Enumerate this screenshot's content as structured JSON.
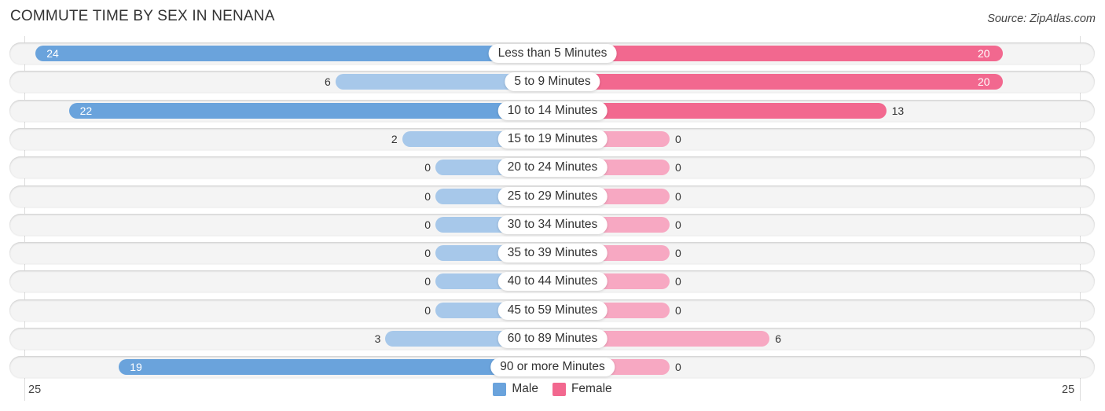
{
  "header": {
    "title": "COMMUTE TIME BY SEX IN NENANA",
    "source": "Source: ZipAtlas.com"
  },
  "colors": {
    "male_strong": "#6aa3dc",
    "male_light": "#a7c8ea",
    "female_strong": "#f2688f",
    "female_light": "#f7a8c2",
    "row_bg": "#f4f4f4"
  },
  "chart_data": {
    "type": "bar",
    "orientation": "horizontal-diverging",
    "title": "COMMUTE TIME BY SEX IN NENANA",
    "categories": [
      "Less than 5 Minutes",
      "5 to 9 Minutes",
      "10 to 14 Minutes",
      "15 to 19 Minutes",
      "20 to 24 Minutes",
      "25 to 29 Minutes",
      "30 to 34 Minutes",
      "35 to 39 Minutes",
      "40 to 44 Minutes",
      "45 to 59 Minutes",
      "60 to 89 Minutes",
      "90 or more Minutes"
    ],
    "series": [
      {
        "name": "Male",
        "values": [
          24,
          6,
          22,
          2,
          0,
          0,
          0,
          0,
          0,
          0,
          3,
          19
        ]
      },
      {
        "name": "Female",
        "values": [
          20,
          20,
          13,
          0,
          0,
          0,
          0,
          0,
          0,
          0,
          6,
          0
        ]
      }
    ],
    "axis": {
      "left_tick": "25",
      "right_tick": "25",
      "max": 25
    },
    "legend": {
      "position": "bottom-center",
      "items": [
        "Male",
        "Female"
      ]
    },
    "grid": false
  }
}
